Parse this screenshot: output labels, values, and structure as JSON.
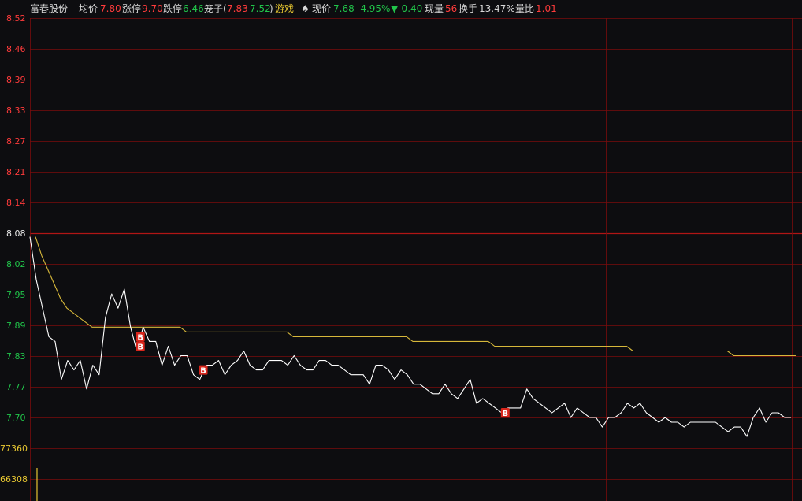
{
  "header": {
    "stock_name": "富春股份",
    "avg_label": "均价",
    "avg_value": "7.80",
    "limit_up_label": "涨停",
    "limit_up_value": "9.70",
    "limit_down_label": "跌停",
    "limit_down_value": "6.46",
    "box_label": "笼子",
    "box_open": "(",
    "box_v1": "7.83",
    "box_v2": "7.52",
    "box_close": ")",
    "sector": "游戏",
    "now_label": "现价",
    "now_value": "7.68",
    "change_pct": "-4.95%",
    "change_abs": "▼-0.40",
    "vol_label": "现量",
    "vol_value": "56",
    "turnover_label": "换手",
    "turnover_value": "13.47%",
    "ratio_label": "量比",
    "ratio_value": "1.01"
  },
  "colors": {
    "background": "#0d0d10",
    "grid": "#7a0d0d",
    "price_line": "#ffffff",
    "avg_line": "#d6b73a",
    "up_text": "#ff3b3b",
    "down_text": "#21c44a",
    "volume_text": "#e6c631",
    "buy_marker": "#d9261c"
  },
  "chart_data": {
    "type": "line",
    "title": "",
    "ylim": [
      7.68,
      8.52
    ],
    "prev_close": 8.08,
    "y_ticks": [
      "8.52",
      "8.46",
      "8.39",
      "8.33",
      "8.27",
      "8.21",
      "8.14",
      "8.08",
      "8.02",
      "7.95",
      "7.89",
      "7.83",
      "7.77",
      "7.70"
    ],
    "volume_ticks": [
      "77360",
      "66308"
    ],
    "buy_marker_label": "B",
    "series": [
      {
        "values": [
          8.06,
          7.97,
          7.91,
          7.85,
          7.84,
          7.76,
          7.8,
          7.78,
          7.8,
          7.74,
          7.79,
          7.77,
          7.89,
          7.94,
          7.91,
          7.95,
          7.87,
          7.82,
          7.87,
          7.84,
          7.84,
          7.79,
          7.83,
          7.79,
          7.81,
          7.81,
          7.77,
          7.76,
          7.79,
          7.79,
          7.8,
          7.77,
          7.79,
          7.8,
          7.82,
          7.79,
          7.78,
          7.78,
          7.8,
          7.8,
          7.8,
          7.79,
          7.81,
          7.79,
          7.78,
          7.78,
          7.8,
          7.8,
          7.79,
          7.79,
          7.78,
          7.77,
          7.77,
          7.77,
          7.75,
          7.79,
          7.79,
          7.78,
          7.76,
          7.78,
          7.77,
          7.75,
          7.75,
          7.74,
          7.73,
          7.73,
          7.75,
          7.73,
          7.72,
          7.74,
          7.76,
          7.71,
          7.72,
          7.71,
          7.7,
          7.69,
          7.7,
          7.7,
          7.7,
          7.74,
          7.72,
          7.71,
          7.7,
          7.69,
          7.7,
          7.71,
          7.68,
          7.7,
          7.69,
          7.68,
          7.68,
          7.66,
          7.68,
          7.68,
          7.69,
          7.71,
          7.7,
          7.71,
          7.69,
          7.68,
          7.67,
          7.68,
          7.67,
          7.67,
          7.66,
          7.67,
          7.67,
          7.67,
          7.67,
          7.67,
          7.66,
          7.65,
          7.66,
          7.66,
          7.64,
          7.68,
          7.7,
          7.67,
          7.69,
          7.69,
          7.68,
          7.68
        ]
      },
      {
        "values": [
          8.06,
          8.02,
          7.99,
          7.96,
          7.93,
          7.91,
          7.9,
          7.89,
          7.88,
          7.87,
          7.87,
          7.87,
          7.87,
          7.87,
          7.87,
          7.87,
          7.87,
          7.87,
          7.87,
          7.87,
          7.87,
          7.87,
          7.87,
          7.87,
          7.86,
          7.86,
          7.86,
          7.86,
          7.86,
          7.86,
          7.86,
          7.86,
          7.86,
          7.86,
          7.86,
          7.86,
          7.86,
          7.86,
          7.86,
          7.86,
          7.86,
          7.85,
          7.85,
          7.85,
          7.85,
          7.85,
          7.85,
          7.85,
          7.85,
          7.85,
          7.85,
          7.85,
          7.85,
          7.85,
          7.85,
          7.85,
          7.85,
          7.85,
          7.85,
          7.85,
          7.84,
          7.84,
          7.84,
          7.84,
          7.84,
          7.84,
          7.84,
          7.84,
          7.84,
          7.84,
          7.84,
          7.84,
          7.84,
          7.83,
          7.83,
          7.83,
          7.83,
          7.83,
          7.83,
          7.83,
          7.83,
          7.83,
          7.83,
          7.83,
          7.83,
          7.83,
          7.83,
          7.83,
          7.83,
          7.83,
          7.83,
          7.83,
          7.83,
          7.83,
          7.83,
          7.82,
          7.82,
          7.82,
          7.82,
          7.82,
          7.82,
          7.82,
          7.82,
          7.82,
          7.82,
          7.82,
          7.82,
          7.82,
          7.82,
          7.82,
          7.82,
          7.81,
          7.81,
          7.81,
          7.81,
          7.81,
          7.81,
          7.81,
          7.81,
          7.81,
          7.81,
          7.81
        ]
      }
    ],
    "buy_markers": [
      {
        "index": 17,
        "price": 7.85
      },
      {
        "index": 17,
        "price": 7.83
      },
      {
        "index": 27,
        "price": 7.78
      },
      {
        "index": 75,
        "price": 7.69
      }
    ],
    "volume_bars": [
      {
        "index": 1,
        "value": 66308
      }
    ]
  }
}
